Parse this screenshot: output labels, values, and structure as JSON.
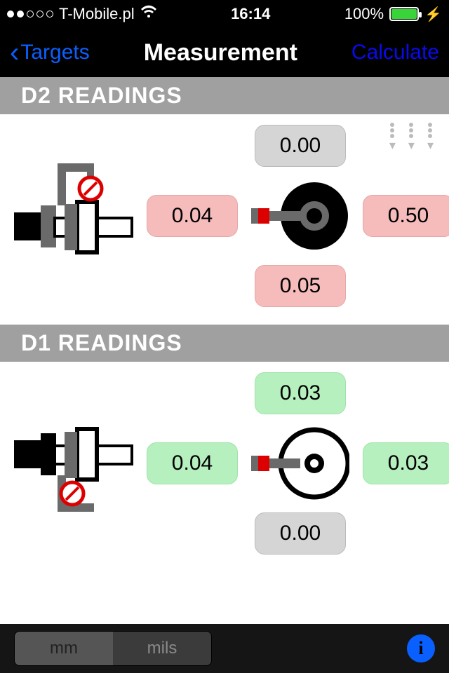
{
  "status_bar": {
    "carrier": "T-Mobile.pl",
    "time": "16:14",
    "battery_pct": "100%"
  },
  "nav": {
    "back_label": "Targets",
    "title": "Measurement",
    "action_label": "Calculate"
  },
  "sections": {
    "d2": {
      "header": "D2 READINGS",
      "top": "0.00",
      "left": "0.04",
      "right": "0.50",
      "bottom": "0.05",
      "top_tone": "gray",
      "left_tone": "pink",
      "right_tone": "pink",
      "bottom_tone": "pink"
    },
    "d1": {
      "header": "D1 READINGS",
      "top": "0.03",
      "left": "0.04",
      "right": "0.03",
      "bottom": "0.00",
      "top_tone": "green",
      "left_tone": "green",
      "right_tone": "green",
      "bottom_tone": "gray"
    }
  },
  "footer": {
    "unit_mm": "mm",
    "unit_mils": "mils",
    "active_unit": "mm"
  }
}
